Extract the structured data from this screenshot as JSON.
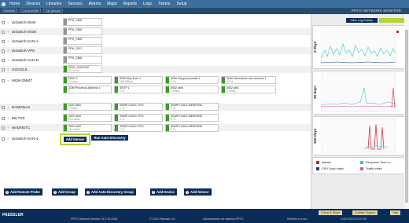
{
  "nav": {
    "items": [
      "Home",
      "Devices",
      "Libraries",
      "Sensors",
      "Alarms",
      "Maps",
      "Reports",
      "Logs",
      "Tickets",
      "Setup"
    ]
  },
  "breadcrumbs": [
    "Devices",
    "Local probe",
    "1st groups"
  ],
  "brand": "PRTG NETWORK MONITOR",
  "groups": [
    {
      "name": "dvSwitch-WAN"
    },
    {
      "name": "dvSwitch-MGM"
    },
    {
      "name": "dvSwitch-SAN-A"
    },
    {
      "name": "dvSwitch-VPS"
    },
    {
      "name": "dvSwitch-SAN-B"
    },
    {
      "name": "GOOGLE"
    },
    {
      "name": "MGM-ZMMT"
    },
    {
      "name": "RAMONAS"
    },
    {
      "name": "EB-TSS"
    },
    {
      "name": "MADMSTC"
    },
    {
      "name": "dvSwitch-SAN-4"
    }
  ],
  "sensors": {
    "s1": {
      "name": "PPH_2385",
      "value": ""
    },
    "s2": {
      "name": "PPH_2385",
      "value": ""
    },
    "s3": {
      "name": "PPH_2385",
      "value": ""
    },
    "s4": {
      "name": "PPH_2397",
      "value": ""
    },
    "s5": {
      "name": "PPH_2385",
      "value": ""
    },
    "s6": {
      "name": "PING_GOOGLE",
      "value": "32 msec"
    },
    "z1": {
      "name": "PING 1",
      "value": "1 msec"
    },
    "z2": {
      "name": "ZDM Disk Free 1",
      "value": "168 MByte"
    },
    "z3": {
      "name": "ZDM Carga promedio 1",
      "value": "0 %"
    },
    "z4": {
      "name": "ZDM Informacion de memoria 1",
      "value": "49 %"
    },
    "z5": {
      "name": "ZDM Procesos Abiertos 1",
      "value": "0"
    },
    "z6": {
      "name": "SNTP 1",
      "value": "0 %"
    },
    "z7": {
      "name": "0002 ath0",
      "value": "1 kbit/s"
    },
    "z8": {
      "name": "0002 ath1",
      "value": "0 kbit/s"
    },
    "r1": {
      "name": "0002 ath0",
      "value": "0 kbit/s"
    },
    "r2": {
      "name": "SNMP LINUX CPU",
      "value": "1 %"
    },
    "r3": {
      "name": "SNMP LINUX MEMORIA",
      "value": "1 %"
    },
    "e1": {
      "name": "0002 ath0",
      "value": "115 kbit/s"
    },
    "e2": {
      "name": "SNMP LINUX CPU",
      "value": "1 %"
    },
    "e3": {
      "name": "SNMP LINUX MEMORIA",
      "value": "1 %"
    },
    "m1": {
      "name": "0002 ath0",
      "value": "110 kbit/s"
    },
    "m2": {
      "name": "SNMP LINUX CPU",
      "value": "1 %"
    },
    "m3": {
      "name": "SNMP LINUX MEMORIA",
      "value": "1 %"
    }
  },
  "actions": {
    "add_sensor": "Add Sensor",
    "auto_discovery": "Run Auto-Discovery"
  },
  "bottom_buttons": [
    "Add Remote Probe",
    "Add Group",
    "Add Auto-Discovery Group",
    "Add Device",
    "Add Sensor"
  ],
  "right": {
    "new_log": "New Log Entries",
    "panels": [
      {
        "label": "2 days"
      },
      {
        "label": "30 days"
      },
      {
        "label": "365 days"
      }
    ],
    "legend": {
      "alarms": "Alarms",
      "cpu": "CPU Load Index",
      "response": "Response Time In...",
      "traffic": "Traffic Index",
      "colors": {
        "alarms": "#c0282d",
        "cpu": "#1a3d8a",
        "response": "#3ec0c8",
        "traffic": "#e04fa1"
      }
    }
  },
  "footer": {
    "logo": "PAESSLER",
    "version": "PRTG Network Monitor 14.2.10.2258",
    "copyright": "© 2014 Paessler AG",
    "admin": "Administrador de sistema PRTG",
    "refresh": "Refresh in 8 sec",
    "time": "21/07/2014 23:07:40",
    "follow": "Follow & Share",
    "support": "Contact Support",
    "help": "Help"
  }
}
